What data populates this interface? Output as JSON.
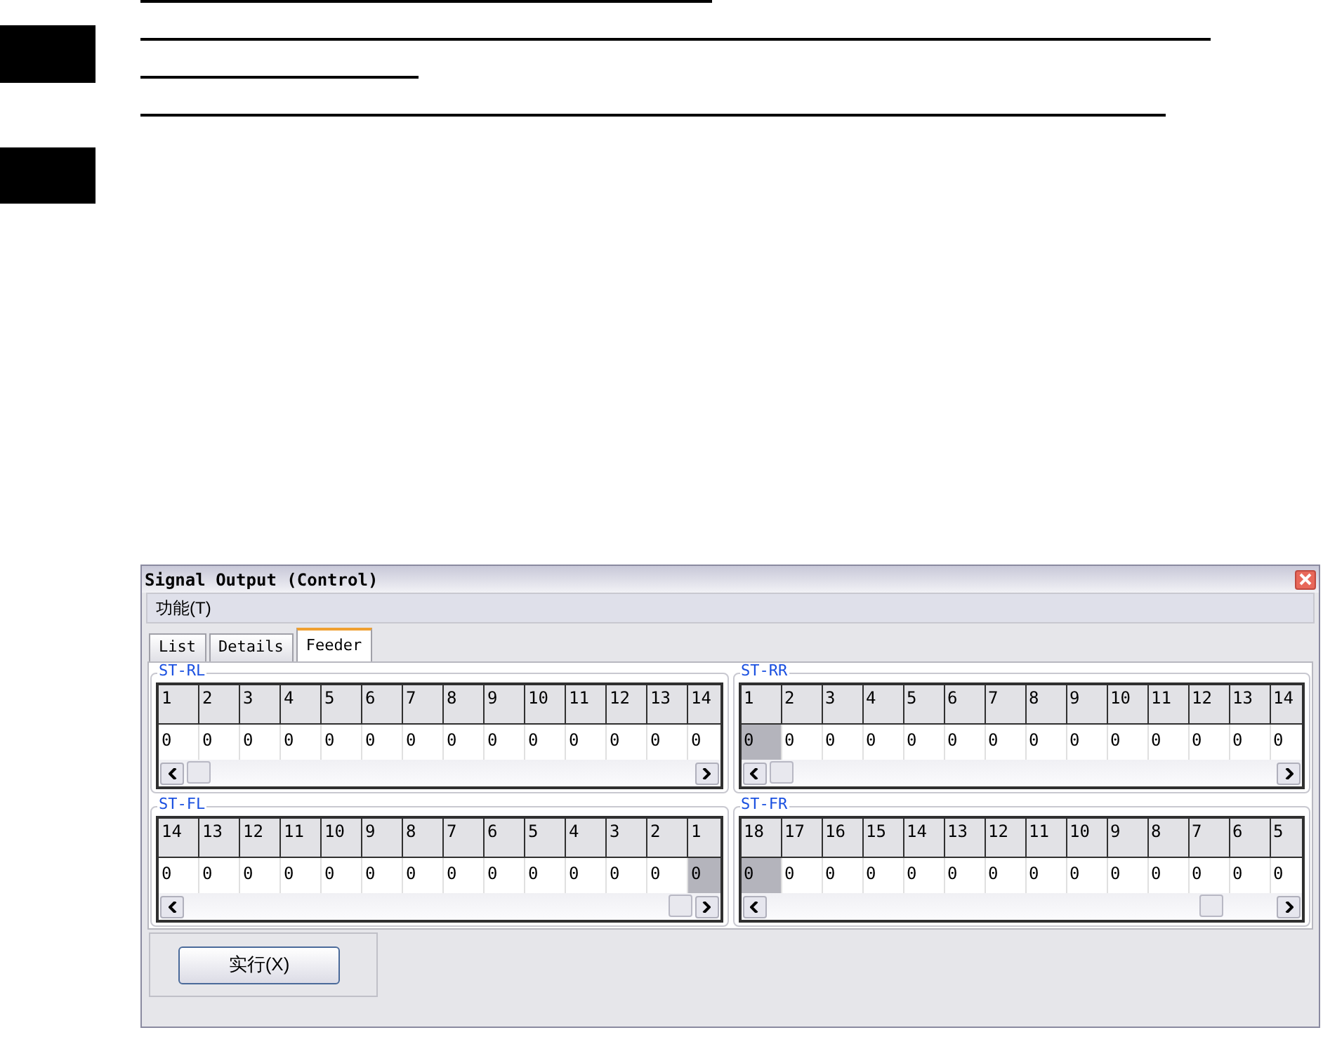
{
  "window": {
    "title": "Signal Output (Control)"
  },
  "menu": [
    "功能(T)"
  ],
  "tabs": [
    {
      "label": "List",
      "selected": false
    },
    {
      "label": "Details",
      "selected": false
    },
    {
      "label": "Feeder",
      "selected": true
    }
  ],
  "grids": [
    {
      "title": "ST-RL",
      "headers": [
        "1",
        "2",
        "3",
        "4",
        "5",
        "6",
        "7",
        "8",
        "9",
        "10",
        "11",
        "12",
        "13",
        "14"
      ],
      "cells": [
        {
          "value": "0",
          "selected": false
        },
        {
          "value": "0",
          "selected": false
        },
        {
          "value": "0",
          "selected": false
        },
        {
          "value": "0",
          "selected": false
        },
        {
          "value": "0",
          "selected": false
        },
        {
          "value": "0",
          "selected": false
        },
        {
          "value": "0",
          "selected": false
        },
        {
          "value": "0",
          "selected": false
        },
        {
          "value": "0",
          "selected": false
        },
        {
          "value": "0",
          "selected": false
        },
        {
          "value": "0",
          "selected": false
        },
        {
          "value": "0",
          "selected": false
        },
        {
          "value": "0",
          "selected": false
        },
        {
          "value": "0",
          "selected": false
        }
      ]
    },
    {
      "title": "ST-RR",
      "headers": [
        "1",
        "2",
        "3",
        "4",
        "5",
        "6",
        "7",
        "8",
        "9",
        "10",
        "11",
        "12",
        "13",
        "14"
      ],
      "cells": [
        {
          "value": "0",
          "selected": true
        },
        {
          "value": "0",
          "selected": false
        },
        {
          "value": "0",
          "selected": false
        },
        {
          "value": "0",
          "selected": false
        },
        {
          "value": "0",
          "selected": false
        },
        {
          "value": "0",
          "selected": false
        },
        {
          "value": "0",
          "selected": false
        },
        {
          "value": "0",
          "selected": false
        },
        {
          "value": "0",
          "selected": false
        },
        {
          "value": "0",
          "selected": false
        },
        {
          "value": "0",
          "selected": false
        },
        {
          "value": "0",
          "selected": false
        },
        {
          "value": "0",
          "selected": false
        },
        {
          "value": "0",
          "selected": false
        }
      ]
    },
    {
      "title": "ST-FL",
      "headers": [
        "14",
        "13",
        "12",
        "11",
        "10",
        "9",
        "8",
        "7",
        "6",
        "5",
        "4",
        "3",
        "2",
        "1"
      ],
      "cells": [
        {
          "value": "0",
          "selected": false
        },
        {
          "value": "0",
          "selected": false
        },
        {
          "value": "0",
          "selected": false
        },
        {
          "value": "0",
          "selected": false
        },
        {
          "value": "0",
          "selected": false
        },
        {
          "value": "0",
          "selected": false
        },
        {
          "value": "0",
          "selected": false
        },
        {
          "value": "0",
          "selected": false
        },
        {
          "value": "0",
          "selected": false
        },
        {
          "value": "0",
          "selected": false
        },
        {
          "value": "0",
          "selected": false
        },
        {
          "value": "0",
          "selected": false
        },
        {
          "value": "0",
          "selected": false
        },
        {
          "value": "0",
          "selected": true
        }
      ]
    },
    {
      "title": "ST-FR",
      "headers": [
        "18",
        "17",
        "16",
        "15",
        "14",
        "13",
        "12",
        "11",
        "10",
        "9",
        "8",
        "7",
        "6",
        "5"
      ],
      "cells": [
        {
          "value": "0",
          "selected": true
        },
        {
          "value": "0",
          "selected": false
        },
        {
          "value": "0",
          "selected": false
        },
        {
          "value": "0",
          "selected": false
        },
        {
          "value": "0",
          "selected": false
        },
        {
          "value": "0",
          "selected": false
        },
        {
          "value": "0",
          "selected": false
        },
        {
          "value": "0",
          "selected": false
        },
        {
          "value": "0",
          "selected": false
        },
        {
          "value": "0",
          "selected": false
        },
        {
          "value": "0",
          "selected": false
        },
        {
          "value": "0",
          "selected": false
        },
        {
          "value": "0",
          "selected": false
        },
        {
          "value": "0",
          "selected": false
        }
      ]
    }
  ],
  "button": {
    "label": "实行(X)"
  }
}
